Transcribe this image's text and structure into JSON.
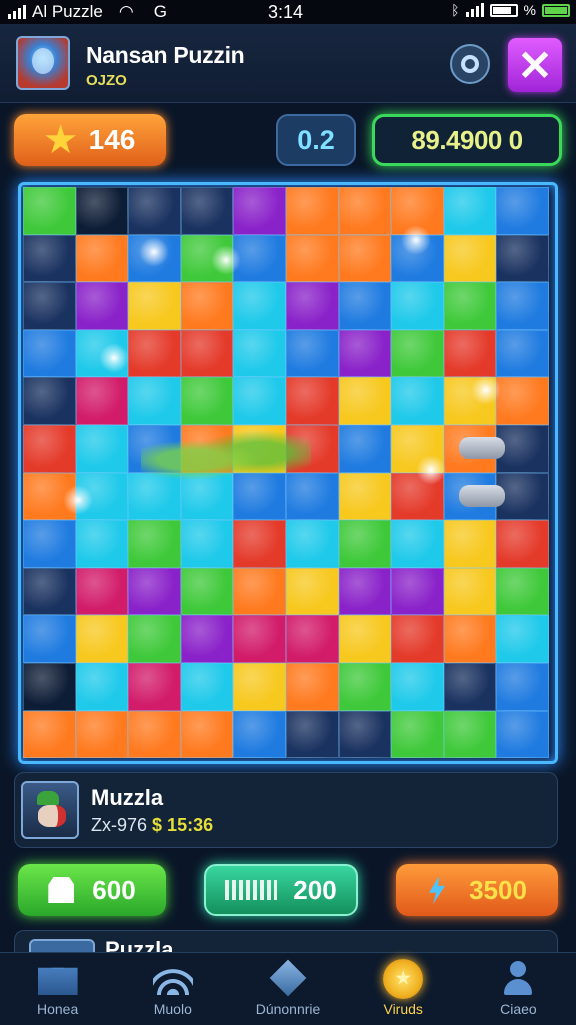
{
  "status_bar": {
    "carrier": "Al Puzzle",
    "g_label": "G",
    "time": "3:14",
    "extra": "%"
  },
  "header": {
    "title": "Nansan Puzzin",
    "subtitle": "OJZO",
    "avatar_icon": "alien-avatar-icon",
    "settings_icon": "target-icon",
    "close_label": "✕"
  },
  "stats": {
    "score": "146",
    "score_icon": "star-icon",
    "multiplier": "0.2",
    "coins": "89.4900 0"
  },
  "board": {
    "rows": 12,
    "cols": 10,
    "palette": {
      "g": "#3fc93a",
      "d": "#1a3260",
      "b": "#1f7be0",
      "c": "#1ec9ea",
      "o": "#ff7a1f",
      "y": "#f7c81e",
      "p": "#8a22c9",
      "r": "#e43a2a",
      "m": "#d21c6a",
      "k": "#0e1d36"
    },
    "cells": [
      "gkddpooocb",
      "dobgboobyd",
      "dpyocpbcgb",
      "bcrrcbpgrb",
      "dmcgcrycyo",
      "rcboyrbyo d",
      "occcbbyrbd",
      "bcgcrcgcyr",
      "dmpgoyppyg",
      "bygpmmyroc",
      "kcmcyogcdb",
      "ooo obddggb"
    ]
  },
  "player": {
    "name": "Muzzla",
    "meta": "Zx-976",
    "time": "$ 15:36"
  },
  "actions": [
    {
      "label": "600",
      "icon": "shield-icon"
    },
    {
      "label": "200",
      "icon": "hammer-icon"
    },
    {
      "label": "3500",
      "icon": "lightning-icon"
    }
  ],
  "next_card": {
    "name": "Puzzla"
  },
  "nav": [
    {
      "label": "Honea",
      "icon": "home-icon"
    },
    {
      "label": "Muolo",
      "icon": "signal-icon"
    },
    {
      "label": "Dúnonnrie",
      "icon": "diamond-icon"
    },
    {
      "label": "Viruds",
      "icon": "coin-icon",
      "active": true
    },
    {
      "label": "Ciaeo",
      "icon": "profile-icon"
    }
  ]
}
